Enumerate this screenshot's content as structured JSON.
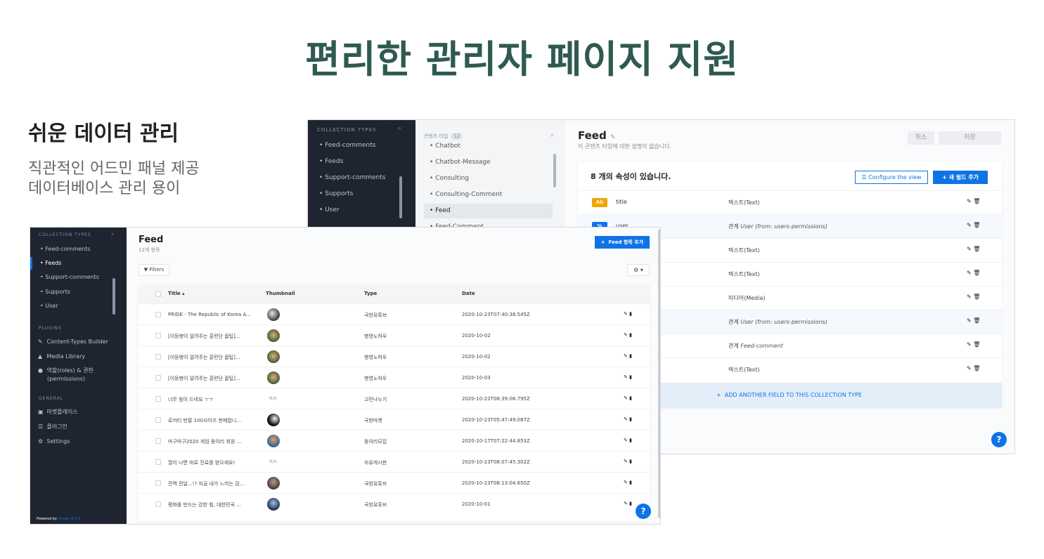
{
  "hero": {
    "title": "편리한 관리자 페이지 지원"
  },
  "intro": {
    "heading": "쉬운 데이터 관리",
    "line1": "직관적인 어드민 패널 제공",
    "line2": "데이터베이스 관리 용이"
  },
  "builder": {
    "sidebar": {
      "header": "COLLECTION TYPES",
      "items": [
        "Feed-comments",
        "Feeds",
        "Support-comments",
        "Supports",
        "User"
      ]
    },
    "types_panel": {
      "header": "콘텐츠 타입",
      "count": "12",
      "items": [
        "Chatbot",
        "Chatbot-Message",
        "Consulting",
        "Consulting-Comment",
        "Feed",
        "Feed-Comment"
      ],
      "active": "Feed"
    },
    "main": {
      "title": "Feed",
      "description": "이 콘텐츠 타입에 대한 설명이 없습니다.",
      "cancel_label": "취소",
      "save_label": "저장",
      "fields_title": "8 개의 속성이 있습니다.",
      "configure_label": "Configure the view",
      "add_field_label": "새 필드 추가",
      "fields": [
        {
          "tag": "Ab",
          "name": "title",
          "type": "텍스트(Text)",
          "rel": ""
        },
        {
          "tag": "%",
          "name": "user",
          "type": "관계",
          "rel": "User (from: users-permissions)"
        },
        {
          "tag": "",
          "name": "",
          "type": "텍스트(Text)",
          "rel": ""
        },
        {
          "tag": "",
          "name": "",
          "type": "텍스트(Text)",
          "rel": ""
        },
        {
          "tag": "",
          "name": "",
          "type": "미디어(Media)",
          "rel": ""
        },
        {
          "tag": "",
          "name": "",
          "type": "관계",
          "rel": "User (from: users-permissions)"
        },
        {
          "tag": "",
          "name": "",
          "type": "관계",
          "rel": "Feed-comment"
        },
        {
          "tag": "",
          "name": "",
          "type": "텍스트(Text)",
          "rel": ""
        }
      ],
      "add_another": "ADD ANOTHER FIELD TO THIS COLLECTION TYPE",
      "help": "?"
    }
  },
  "list": {
    "sidebar": {
      "header": "COLLECTION TYPES",
      "items": [
        "Feed-comments",
        "Feeds",
        "Support-comments",
        "Supports",
        "User"
      ],
      "active": "Feeds",
      "plugins_header": "PLUGINS",
      "plugins": [
        "Content-Types Builder",
        "Media Library",
        "역할(roles) & 권한",
        "(permissions)"
      ],
      "general_header": "GENERAL",
      "general": [
        "마켓플레이스",
        "플러그인",
        "Settings"
      ],
      "powered_prefix": "Powered by",
      "powered_brand": "Strapi v3.0.6"
    },
    "main": {
      "title": "Feed",
      "count": "12개 항목",
      "add_label": "Feed 항목 추가",
      "filters_label": "Filters",
      "columns": [
        "Title ▴",
        "Thumbnail",
        "Type",
        "Date"
      ],
      "rows": [
        {
          "title": "PRIDE - The Republic of Korea A...",
          "thumb": "img",
          "type": "국방유튜브",
          "date": "2020-10-23T07:40:38.545Z"
        },
        {
          "title": "[이등병이 알려주는 훈련단 꿀팁]...",
          "thumb": "img",
          "type": "병영노하우",
          "date": "2020-10-02"
        },
        {
          "title": "[이등병이 알려주는 훈련단 꿀팁]...",
          "thumb": "img",
          "type": "병영노하우",
          "date": "2020-10-02"
        },
        {
          "title": "[이등병이 알려주는 훈련단 꿀팁]...",
          "thumb": "img",
          "type": "병영노하우",
          "date": "2020-10-03"
        },
        {
          "title": "너무 힘이 드네요 ㅜㅜ",
          "thumb": "N/A",
          "type": "고민나누기",
          "date": "2020-10-22T08:39:06.795Z"
        },
        {
          "title": "로카티 반팔 100사이즈 판매합니...",
          "thumb": "img",
          "type": "국방마켓",
          "date": "2020-10-23T05:47:49.087Z"
        },
        {
          "title": "마구마구2020 게임 동아리 회원 ...",
          "thumb": "img",
          "type": "동아리모집",
          "date": "2020-10-17T07:22:44.853Z"
        },
        {
          "title": "열이 나면 바로 진료를 받으세요!",
          "thumb": "N/A",
          "type": "자유게시판",
          "date": "2020-10-23T08:07:45.302Z"
        },
        {
          "title": "전역 전날...!? 지금 내가 느끼는 감...",
          "thumb": "img",
          "type": "국방유튜브",
          "date": "2020-10-23T08:13:04.650Z"
        },
        {
          "title": "평화를 만드는 강한 힘, 대한민국 ...",
          "thumb": "img",
          "type": "국방유튜브",
          "date": "2020-10-01"
        }
      ],
      "help": "?"
    }
  },
  "colors": {
    "accent": "#0f73e6",
    "sidebar": "#1e2530",
    "title": "#2f5a52",
    "tag_text": "#f0a500",
    "tag_relation": "#0f73e6"
  }
}
